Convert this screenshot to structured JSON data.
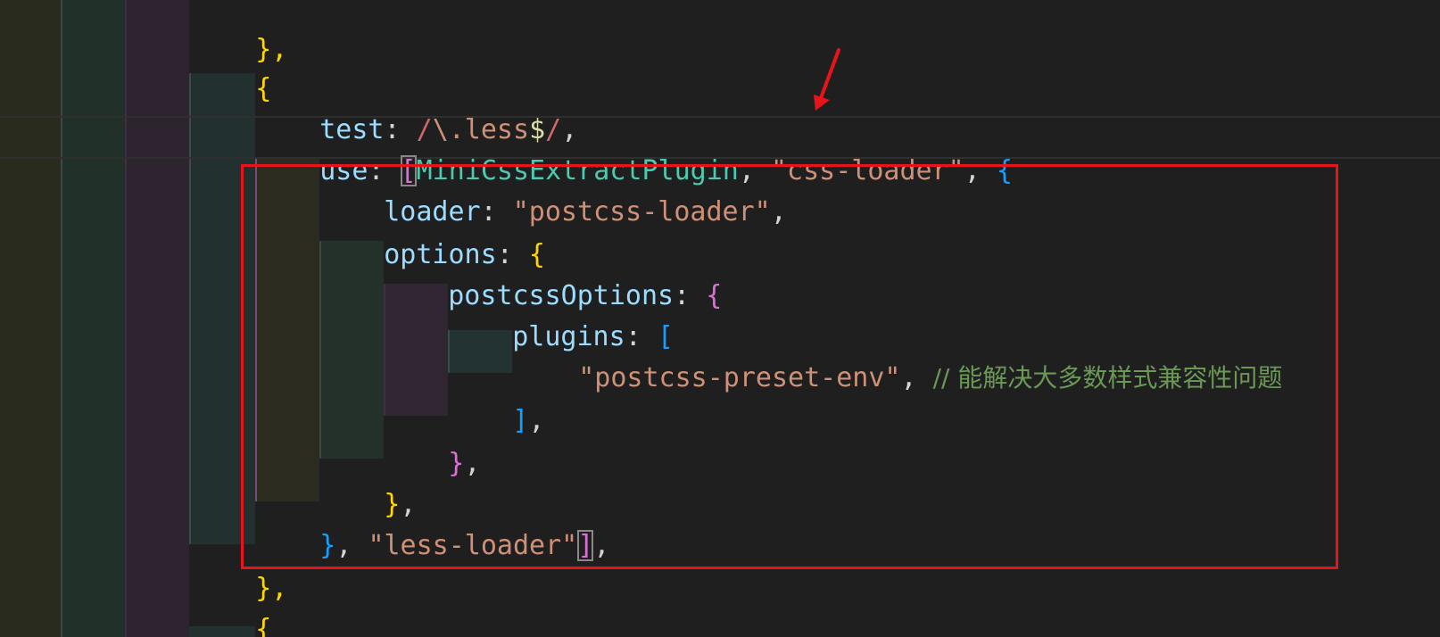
{
  "code": {
    "line_close_obj": "},",
    "line_open_obj": "{",
    "test_key": "test",
    "test_colon": ": ",
    "test_regex_slash1": "/",
    "test_regex_body": "\\.less",
    "test_regex_dollar": "$",
    "test_regex_slash2": "/",
    "test_comma": ",",
    "use_key": "use",
    "use_colon": ": ",
    "use_bracket_open": "[",
    "use_plugin": "MiniCssExtractPlugin",
    "use_sep1": ", ",
    "use_css_loader": "\"css-loader\"",
    "use_sep2": ", ",
    "use_brace": "{",
    "loader_key": "loader",
    "loader_colon": ": ",
    "loader_value": "\"postcss-loader\"",
    "loader_comma": ",",
    "options_key": "options",
    "options_colon": ": ",
    "options_brace": "{",
    "postcss_options_key": "postcssOptions",
    "postcss_options_colon": ": ",
    "postcss_options_brace": "{",
    "plugins_key": "plugins",
    "plugins_colon": ": ",
    "plugins_bracket": "[",
    "preset_value": "\"postcss-preset-env\"",
    "preset_comma": ", ",
    "preset_comment": "// 能解决大多数样式兼容性问题",
    "plugins_close": "]",
    "plugins_close_comma": ",",
    "postcss_options_close": "}",
    "postcss_options_close_comma": ",",
    "options_close": "}",
    "options_close_comma": ",",
    "use_obj_close": "}",
    "use_sep3": ", ",
    "less_loader": "\"less-loader\"",
    "use_bracket_close": "]",
    "use_close_comma": ",",
    "rule_close": "},",
    "rule_open": "{"
  },
  "colors": {
    "annotation_red": "#e8141b"
  }
}
